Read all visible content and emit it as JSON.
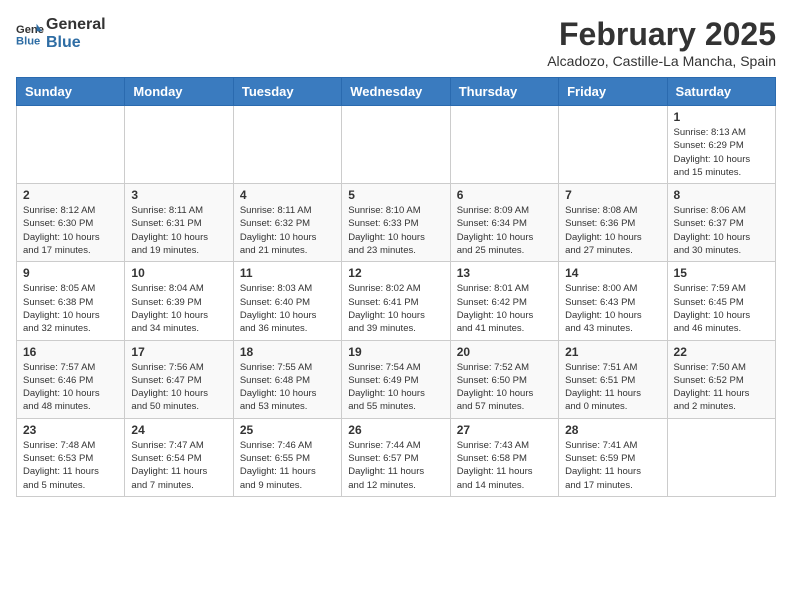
{
  "header": {
    "logo_line1": "General",
    "logo_line2": "Blue",
    "month_year": "February 2025",
    "location": "Alcadozo, Castille-La Mancha, Spain"
  },
  "weekdays": [
    "Sunday",
    "Monday",
    "Tuesday",
    "Wednesday",
    "Thursday",
    "Friday",
    "Saturday"
  ],
  "weeks": [
    [
      {
        "day": "",
        "info": ""
      },
      {
        "day": "",
        "info": ""
      },
      {
        "day": "",
        "info": ""
      },
      {
        "day": "",
        "info": ""
      },
      {
        "day": "",
        "info": ""
      },
      {
        "day": "",
        "info": ""
      },
      {
        "day": "1",
        "info": "Sunrise: 8:13 AM\nSunset: 6:29 PM\nDaylight: 10 hours\nand 15 minutes."
      }
    ],
    [
      {
        "day": "2",
        "info": "Sunrise: 8:12 AM\nSunset: 6:30 PM\nDaylight: 10 hours\nand 17 minutes."
      },
      {
        "day": "3",
        "info": "Sunrise: 8:11 AM\nSunset: 6:31 PM\nDaylight: 10 hours\nand 19 minutes."
      },
      {
        "day": "4",
        "info": "Sunrise: 8:11 AM\nSunset: 6:32 PM\nDaylight: 10 hours\nand 21 minutes."
      },
      {
        "day": "5",
        "info": "Sunrise: 8:10 AM\nSunset: 6:33 PM\nDaylight: 10 hours\nand 23 minutes."
      },
      {
        "day": "6",
        "info": "Sunrise: 8:09 AM\nSunset: 6:34 PM\nDaylight: 10 hours\nand 25 minutes."
      },
      {
        "day": "7",
        "info": "Sunrise: 8:08 AM\nSunset: 6:36 PM\nDaylight: 10 hours\nand 27 minutes."
      },
      {
        "day": "8",
        "info": "Sunrise: 8:06 AM\nSunset: 6:37 PM\nDaylight: 10 hours\nand 30 minutes."
      }
    ],
    [
      {
        "day": "9",
        "info": "Sunrise: 8:05 AM\nSunset: 6:38 PM\nDaylight: 10 hours\nand 32 minutes."
      },
      {
        "day": "10",
        "info": "Sunrise: 8:04 AM\nSunset: 6:39 PM\nDaylight: 10 hours\nand 34 minutes."
      },
      {
        "day": "11",
        "info": "Sunrise: 8:03 AM\nSunset: 6:40 PM\nDaylight: 10 hours\nand 36 minutes."
      },
      {
        "day": "12",
        "info": "Sunrise: 8:02 AM\nSunset: 6:41 PM\nDaylight: 10 hours\nand 39 minutes."
      },
      {
        "day": "13",
        "info": "Sunrise: 8:01 AM\nSunset: 6:42 PM\nDaylight: 10 hours\nand 41 minutes."
      },
      {
        "day": "14",
        "info": "Sunrise: 8:00 AM\nSunset: 6:43 PM\nDaylight: 10 hours\nand 43 minutes."
      },
      {
        "day": "15",
        "info": "Sunrise: 7:59 AM\nSunset: 6:45 PM\nDaylight: 10 hours\nand 46 minutes."
      }
    ],
    [
      {
        "day": "16",
        "info": "Sunrise: 7:57 AM\nSunset: 6:46 PM\nDaylight: 10 hours\nand 48 minutes."
      },
      {
        "day": "17",
        "info": "Sunrise: 7:56 AM\nSunset: 6:47 PM\nDaylight: 10 hours\nand 50 minutes."
      },
      {
        "day": "18",
        "info": "Sunrise: 7:55 AM\nSunset: 6:48 PM\nDaylight: 10 hours\nand 53 minutes."
      },
      {
        "day": "19",
        "info": "Sunrise: 7:54 AM\nSunset: 6:49 PM\nDaylight: 10 hours\nand 55 minutes."
      },
      {
        "day": "20",
        "info": "Sunrise: 7:52 AM\nSunset: 6:50 PM\nDaylight: 10 hours\nand 57 minutes."
      },
      {
        "day": "21",
        "info": "Sunrise: 7:51 AM\nSunset: 6:51 PM\nDaylight: 11 hours\nand 0 minutes."
      },
      {
        "day": "22",
        "info": "Sunrise: 7:50 AM\nSunset: 6:52 PM\nDaylight: 11 hours\nand 2 minutes."
      }
    ],
    [
      {
        "day": "23",
        "info": "Sunrise: 7:48 AM\nSunset: 6:53 PM\nDaylight: 11 hours\nand 5 minutes."
      },
      {
        "day": "24",
        "info": "Sunrise: 7:47 AM\nSunset: 6:54 PM\nDaylight: 11 hours\nand 7 minutes."
      },
      {
        "day": "25",
        "info": "Sunrise: 7:46 AM\nSunset: 6:55 PM\nDaylight: 11 hours\nand 9 minutes."
      },
      {
        "day": "26",
        "info": "Sunrise: 7:44 AM\nSunset: 6:57 PM\nDaylight: 11 hours\nand 12 minutes."
      },
      {
        "day": "27",
        "info": "Sunrise: 7:43 AM\nSunset: 6:58 PM\nDaylight: 11 hours\nand 14 minutes."
      },
      {
        "day": "28",
        "info": "Sunrise: 7:41 AM\nSunset: 6:59 PM\nDaylight: 11 hours\nand 17 minutes."
      },
      {
        "day": "",
        "info": ""
      }
    ]
  ]
}
